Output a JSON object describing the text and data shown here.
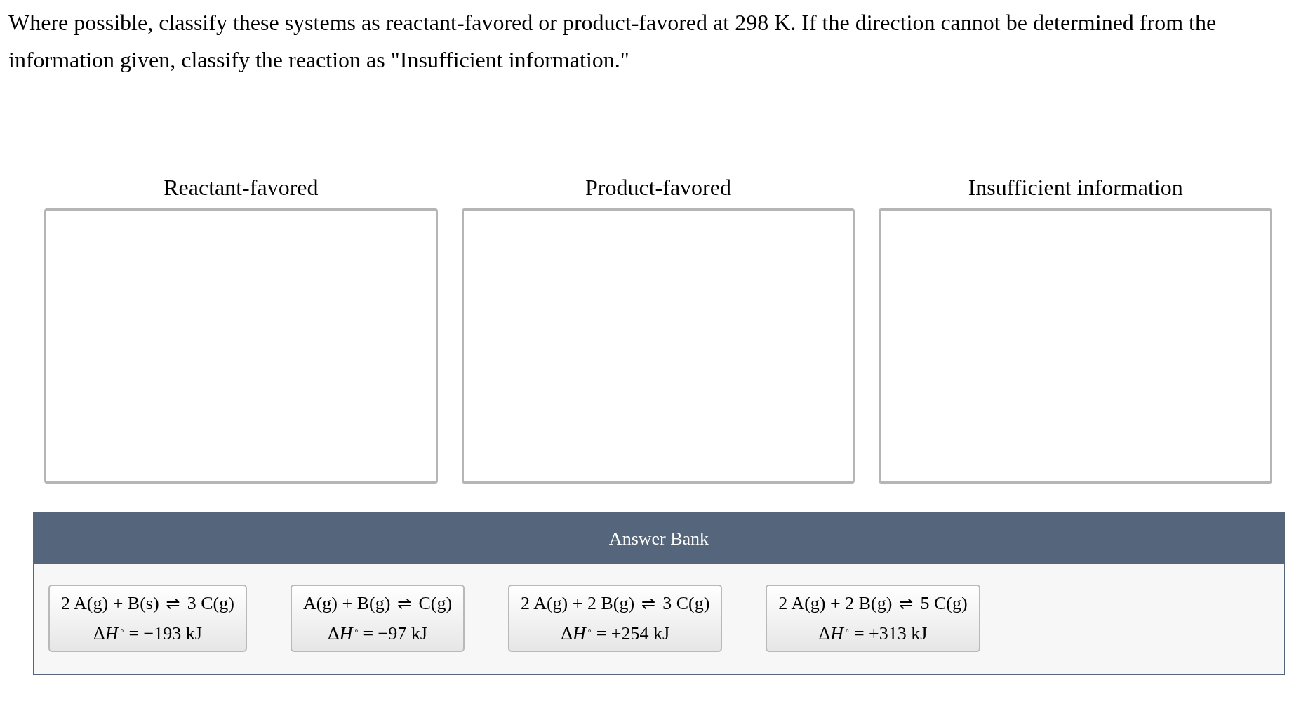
{
  "instructions": "Where possible, classify these systems as reactant-favored or product-favored at 298 K. If the direction cannot be determined from the information given, classify the reaction as \"Insufficient information.\"",
  "bins": [
    {
      "label": "Reactant-favored"
    },
    {
      "label": "Product-favored"
    },
    {
      "label": "Insufficient information"
    }
  ],
  "answer_bank": {
    "title": "Answer Bank",
    "cards": [
      {
        "reactants": "2 A(g) + B(s)",
        "arrow": "⇌",
        "products": "3 C(g)",
        "enthalpy": {
          "prefix": "Δ",
          "symbol": "H",
          "mark": "°",
          "value": "= −193 kJ"
        }
      },
      {
        "reactants": "A(g) + B(g)",
        "arrow": "⇌",
        "products": "C(g)",
        "enthalpy": {
          "prefix": "Δ",
          "symbol": "H",
          "mark": "°",
          "value": "= −97 kJ"
        }
      },
      {
        "reactants": "2 A(g) + 2 B(g)",
        "arrow": "⇌",
        "products": "3 C(g)",
        "enthalpy": {
          "prefix": "Δ",
          "symbol": "H",
          "mark": "°",
          "value": "= +254 kJ"
        }
      },
      {
        "reactants": "2 A(g) + 2 B(g)",
        "arrow": "⇌",
        "products": "5 C(g)",
        "enthalpy": {
          "prefix": "Δ",
          "symbol": "H",
          "mark": "°",
          "value": "= +313 kJ"
        }
      }
    ]
  }
}
